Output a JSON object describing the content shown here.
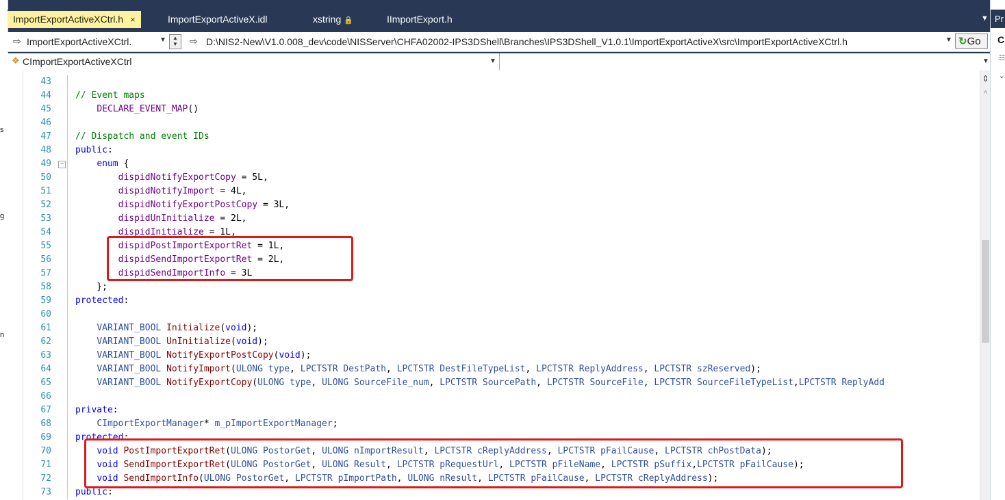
{
  "tabs": [
    {
      "label": "ImportExportActiveXCtrl.h",
      "active": true,
      "close": "×"
    },
    {
      "label": "ImportExportActiveX.idl"
    },
    {
      "label": "xstring",
      "lock": "🔒"
    },
    {
      "label": "IImportExport.h"
    }
  ],
  "nav": {
    "class_combo": "ImportExportActiveXCtrl.",
    "path": "D:\\NIS2-New\\V1.0.008_dev\\code\\NISServer\\CHFA02002-IPS3DShell\\Branches\\IPS3DShell_V1.0.1\\ImportExportActiveX\\src\\ImportExportActiveXCtrl.h",
    "go": "Go"
  },
  "combo": {
    "class": "CImportExportActiveXCtrl"
  },
  "right_panel": {
    "title": "Pr",
    "letter": "C"
  },
  "left_strip": [
    "s",
    "g",
    "n"
  ],
  "code": {
    "lines": [
      {
        "n": "43",
        "t": ""
      },
      {
        "n": "44",
        "t": "// Event maps"
      },
      {
        "n": "45",
        "t": "    DECLARE_EVENT_MAP()"
      },
      {
        "n": "46",
        "t": ""
      },
      {
        "n": "47",
        "t": "// Dispatch and event IDs"
      },
      {
        "n": "48",
        "t": "public:"
      },
      {
        "n": "49",
        "t": "    enum {"
      },
      {
        "n": "50",
        "t": "        dispidNotifyExportCopy = 5L,"
      },
      {
        "n": "51",
        "t": "        dispidNotifyImport = 4L,"
      },
      {
        "n": "52",
        "t": "        dispidNotifyExportPostCopy = 3L,"
      },
      {
        "n": "53",
        "t": "        dispidUnInitialize = 2L,"
      },
      {
        "n": "54",
        "t": "        dispidInitialize = 1L,"
      },
      {
        "n": "55",
        "t": "        dispidPostImportExportRet = 1L,"
      },
      {
        "n": "56",
        "t": "        dispidSendImportExportRet = 2L,"
      },
      {
        "n": "57",
        "t": "        dispidSendImportInfo = 3L"
      },
      {
        "n": "58",
        "t": "    };"
      },
      {
        "n": "59",
        "t": "protected:"
      },
      {
        "n": "60",
        "t": ""
      },
      {
        "n": "61",
        "t": "    VARIANT_BOOL Initialize(void);"
      },
      {
        "n": "62",
        "t": "    VARIANT_BOOL UnInitialize(void);"
      },
      {
        "n": "63",
        "t": "    VARIANT_BOOL NotifyExportPostCopy(void);"
      },
      {
        "n": "64",
        "t": "    VARIANT_BOOL NotifyImport(ULONG type, LPCTSTR DestPath, LPCTSTR DestFileTypeList, LPCTSTR ReplyAddress, LPCTSTR szReserved);"
      },
      {
        "n": "65",
        "t": "    VARIANT_BOOL NotifyExportCopy(ULONG type, ULONG SourceFile_num, LPCTSTR SourcePath, LPCTSTR SourceFile, LPCTSTR SourceFileTypeList,LPCTSTR ReplyAdd"
      },
      {
        "n": "66",
        "t": ""
      },
      {
        "n": "67",
        "t": "private:"
      },
      {
        "n": "68",
        "t": "    CImportExportManager* m_pImportExportManager;"
      },
      {
        "n": "69",
        "t": "protected:"
      },
      {
        "n": "70",
        "t": "    void PostImportExportRet(ULONG PostorGet, ULONG nImportResult, LPCTSTR cReplyAddress, LPCTSTR pFailCause, LPCTSTR chPostData);"
      },
      {
        "n": "71",
        "t": "    void SendImportExportRet(ULONG PostorGet, ULONG Result, LPCTSTR pRequestUrl, LPCTSTR pFileName, LPCTSTR pSuffix,LPCTSTR pFailCause);"
      },
      {
        "n": "72",
        "t": "    void SendImportInfo(ULONG PostorGet, LPCTSTR pImportPath, ULONG nResult, LPCTSTR pFailCause, LPCTSTR cReplyAddress);"
      },
      {
        "n": "73",
        "t": "public:"
      }
    ]
  }
}
